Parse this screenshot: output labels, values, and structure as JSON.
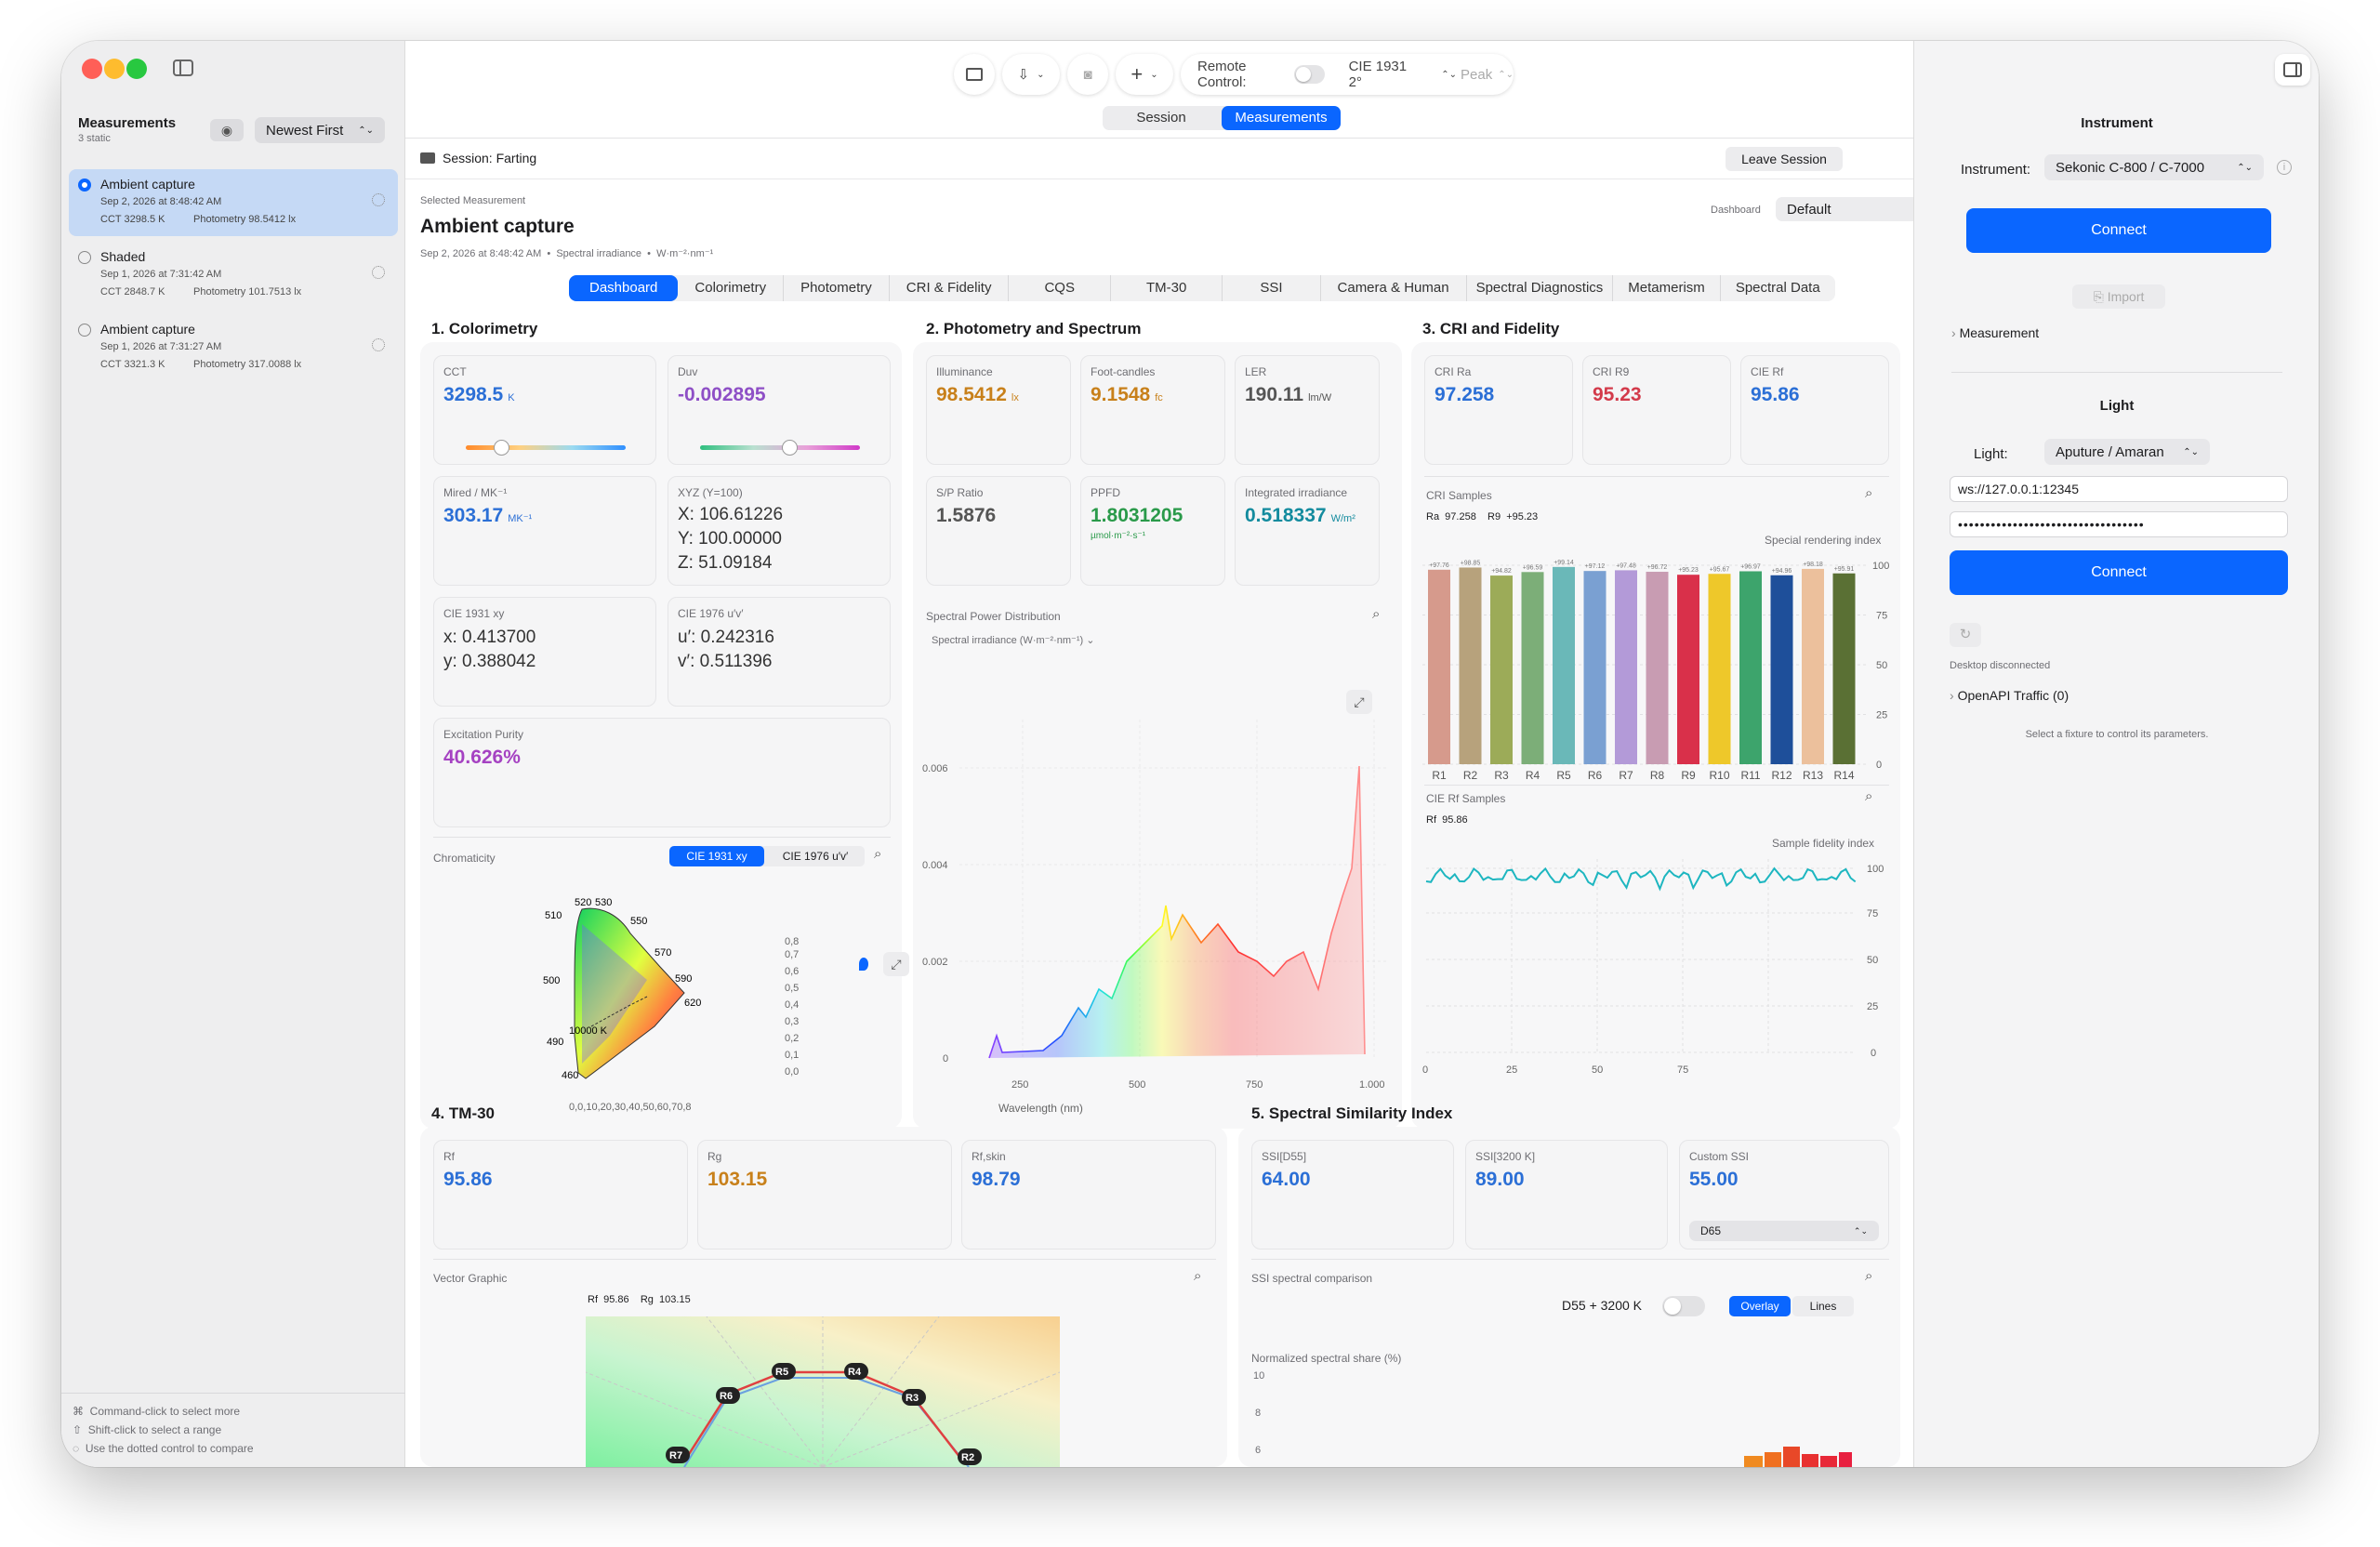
{
  "toolbar": {
    "remote_label": "Remote Control:",
    "observer": "CIE 1931 2°",
    "peak": "Peak"
  },
  "top_tabs": {
    "session": "Session",
    "measurements": "Measurements"
  },
  "sidebar": {
    "title": "Measurements",
    "count": "3 static",
    "sort": "Newest First",
    "items": [
      {
        "name": "Ambient capture",
        "date": "Sep 2, 2026 at 8:48:42 AM",
        "cct": "CCT 3298.5 K",
        "photometry": "Photometry 98.5412 lx"
      },
      {
        "name": "Shaded",
        "date": "Sep 1, 2026 at 7:31:42 AM",
        "cct": "CCT 2848.7 K",
        "photometry": "Photometry 101.7513 lx"
      },
      {
        "name": "Ambient capture",
        "date": "Sep 1, 2026 at 7:31:27 AM",
        "cct": "CCT 3321.3 K",
        "photometry": "Photometry 317.0088 lx"
      }
    ],
    "hints": [
      "Command-click to select more",
      "Shift-click to select a range",
      "Use the dotted control to compare"
    ]
  },
  "session": {
    "label": "Session: Farting",
    "leave": "Leave Session"
  },
  "measurement": {
    "selected_label": "Selected Measurement",
    "title": "Ambient capture",
    "meta": "Sep 2, 2026 at 8:48:42 AM  •  Spectral irradiance  •  W·m⁻²·nm⁻¹",
    "dashboard_label": "Dashboard",
    "dashboard_value": "Default"
  },
  "tabs": [
    "Dashboard",
    "Colorimetry",
    "Photometry",
    "CRI & Fidelity",
    "CQS",
    "TM-30",
    "SSI",
    "Camera & Human",
    "Spectral Diagnostics",
    "Metamerism",
    "Spectral Data"
  ],
  "colorimetry": {
    "title": "1. Colorimetry",
    "cct": {
      "label": "CCT",
      "value": "3298.5",
      "unit": "K"
    },
    "duv": {
      "label": "Duv",
      "value": "-0.002895"
    },
    "mired": {
      "label": "Mired / MK⁻¹",
      "value": "303.17",
      "unit": "MK⁻¹"
    },
    "xyz": {
      "label": "XYZ (Y=100)",
      "x": "X: 106.61226",
      "y": "Y: 100.00000",
      "z": "Z: 51.09184"
    },
    "xy": {
      "label": "CIE 1931 xy",
      "x": "x: 0.413700",
      "y": "y: 0.388042"
    },
    "uv": {
      "label": "CIE 1976 u′v′",
      "u": "u′: 0.242316",
      "v": "v′: 0.511396"
    },
    "purity": {
      "label": "Excitation Purity",
      "value": "40.626%"
    },
    "chroma": {
      "label": "Chromaticity",
      "btn1": "CIE 1931 xy",
      "btn2": "CIE 1976 u′v′",
      "wl": [
        "520",
        "530",
        "510",
        "550",
        "570",
        "500",
        "590",
        "490",
        "620",
        "460"
      ],
      "cct_label": "10000 K",
      "yticks": [
        "0,8",
        "0,7",
        "0,6",
        "0,5",
        "0,4",
        "0,3",
        "0,2",
        "0,1",
        "0,0"
      ],
      "xticks": "0,0,10,20,30,40,50,60,70,8"
    }
  },
  "photometry": {
    "title": "2. Photometry and Spectrum",
    "illum": {
      "label": "Illuminance",
      "value": "98.5412",
      "unit": "lx"
    },
    "fc": {
      "label": "Foot-candles",
      "value": "9.1548",
      "unit": "fc"
    },
    "ler": {
      "label": "LER",
      "value": "190.11",
      "unit": "lm/W"
    },
    "sp": {
      "label": "S/P Ratio",
      "value": "1.5876"
    },
    "ppfd": {
      "label": "PPFD",
      "value": "1.8031205",
      "unit": "µmol·m⁻²·s⁻¹"
    },
    "irr": {
      "label": "Integrated irradiance",
      "value": "0.518337",
      "unit": "W/m²"
    },
    "spd": {
      "label": "Spectral Power Distribution",
      "select": "Spectral irradiance (W·m⁻²·nm⁻¹)",
      "xlabel": "Wavelength (nm)"
    }
  },
  "cri": {
    "title": "3. CRI and Fidelity",
    "ra": {
      "label": "CRI Ra",
      "value": "97.258"
    },
    "r9": {
      "label": "CRI R9",
      "value": "95.23"
    },
    "rf": {
      "label": "CIE Rf",
      "value": "95.86"
    },
    "samples_label": "CRI Samples",
    "ra_row": "Ra  97.258    R9  +95.23",
    "bar_title": "Special rendering index",
    "rf_samples_label": "CIE Rf Samples",
    "rf_row": "Rf  95.86",
    "rf_title": "Sample fidelity index"
  },
  "tm30": {
    "title": "4. TM-30",
    "rf": {
      "label": "Rf",
      "value": "95.86"
    },
    "rg": {
      "label": "Rg",
      "value": "103.15"
    },
    "skin": {
      "label": "Rf,skin",
      "value": "98.79"
    },
    "vector_label": "Vector Graphic",
    "vector_row": "Rf  95.86    Rg  103.15"
  },
  "ssi": {
    "title": "5. Spectral Similarity Index",
    "d55": {
      "label": "SSI[D55]",
      "value": "64.00"
    },
    "k3200": {
      "label": "SSI[3200 K]",
      "value": "89.00"
    },
    "custom": {
      "label": "Custom SSI",
      "value": "55.00"
    },
    "custom_ref": "D65",
    "comp_label": "SSI spectral comparison",
    "pair": "D55 + 3200 K",
    "overlay": "Overlay",
    "lines": "Lines",
    "norm_label": "Normalized spectral share (%)",
    "yticks": [
      "10",
      "8",
      "6"
    ]
  },
  "instrument": {
    "title": "Instrument",
    "label": "Instrument:",
    "value": "Sekonic C-800 / C-7000",
    "connect": "Connect",
    "import": "Import",
    "measurement": "Measurement"
  },
  "light": {
    "title": "Light",
    "label": "Light:",
    "value": "Aputure / Amaran",
    "url": "ws://127.0.0.1:12345",
    "password": "••••••••••••••••••••••••••••••••••",
    "connect": "Connect",
    "status": "Desktop disconnected",
    "openapi": "OpenAPI Traffic (0)",
    "hint": "Select a fixture to control its parameters."
  },
  "chart_data": [
    {
      "type": "bar",
      "title": "Special rendering index",
      "categories": [
        "R1",
        "R2",
        "R3",
        "R4",
        "R5",
        "R6",
        "R7",
        "R8",
        "R9",
        "R10",
        "R11",
        "R12",
        "R13",
        "R14"
      ],
      "values": [
        97.76,
        98.85,
        94.82,
        96.59,
        99.14,
        97.12,
        97.48,
        96.72,
        95.23,
        95.67,
        96.97,
        94.96,
        98.18,
        95.91
      ],
      "ylim": [
        0,
        100
      ],
      "yticks": [
        "100",
        "75",
        "50",
        "25",
        "0"
      ],
      "colors": [
        "#d69a8c",
        "#b7a27c",
        "#9cab58",
        "#7cae78",
        "#6ab8b8",
        "#7aa0d2",
        "#b39ad8",
        "#c89cb2",
        "#d9304a",
        "#eec82a",
        "#3da46c",
        "#1e4f9a",
        "#ecc09c",
        "#5a7034"
      ]
    },
    {
      "type": "line",
      "title": "Sample fidelity index",
      "ylim": [
        0,
        100
      ],
      "yticks": [
        "100",
        "75",
        "50",
        "25",
        "0"
      ],
      "xticks": [
        "0",
        "25",
        "50",
        "75"
      ]
    },
    {
      "type": "area",
      "title": "Spectral Power Distribution",
      "xlabel": "Wavelength (nm)",
      "yticks": [
        "0.006",
        "0.004",
        "0.002",
        "0"
      ],
      "xticks": [
        "250",
        "500",
        "750",
        "1.000"
      ]
    },
    {
      "type": "scatter",
      "title": "Vector Graphic",
      "labels": [
        "R7",
        "R6",
        "R5",
        "R4",
        "R3",
        "R2"
      ]
    }
  ]
}
